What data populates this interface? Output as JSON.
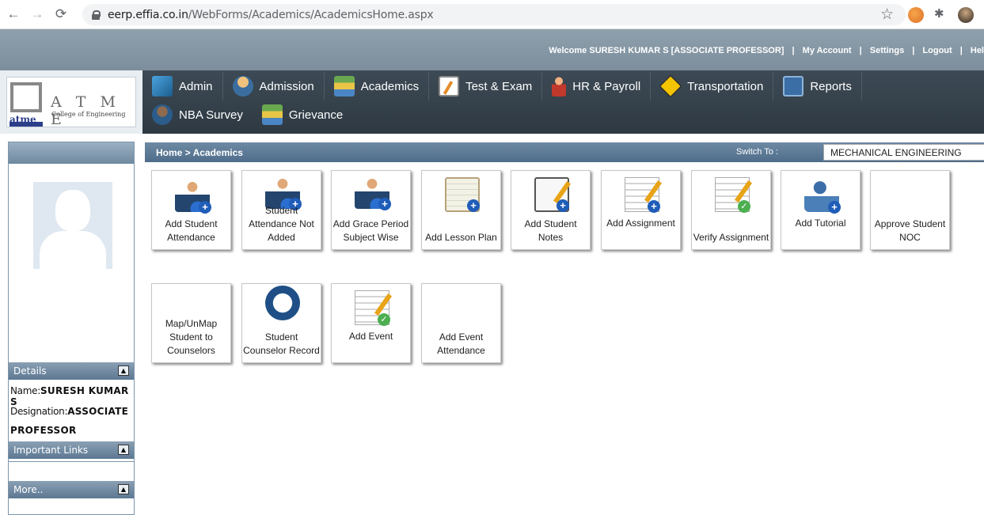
{
  "browser": {
    "url_host": "eerp.effia.co.in",
    "url_path": "/WebForms/Academics/AcademicsHome.aspx"
  },
  "header": {
    "welcome": "Welcome SURESH KUMAR S [ASSOCIATE PROFESSOR]",
    "links": [
      "My Account",
      "Settings",
      "Logout",
      "Hel"
    ],
    "separator": "|"
  },
  "logo": {
    "letters": "A T M E",
    "subtitle": "College of Engineering",
    "short": "atme"
  },
  "menu": {
    "row1": [
      {
        "label": "Admin",
        "icon": "admin-icon"
      },
      {
        "label": "Admission",
        "icon": "admission-icon"
      },
      {
        "label": "Academics",
        "icon": "academics-icon"
      },
      {
        "label": "Test & Exam",
        "icon": "test-exam-icon"
      },
      {
        "label": "HR & Payroll",
        "icon": "hr-payroll-icon"
      },
      {
        "label": "Transportation",
        "icon": "transportation-icon"
      },
      {
        "label": "Reports",
        "icon": "reports-icon"
      }
    ],
    "row2": [
      {
        "label": "NBA Survey",
        "icon": "nba-survey-icon"
      },
      {
        "label": "Grievance",
        "icon": "grievance-icon"
      }
    ]
  },
  "sidebar": {
    "details_title": "Details",
    "name_label": "Name:",
    "name_value": "SURESH KUMAR S",
    "designation_label": "Designation:",
    "designation_value_1": "ASSOCIATE",
    "designation_value_2": "PROFESSOR",
    "links_title": "Important Links",
    "more_title": "More..",
    "toggle": "▲"
  },
  "content": {
    "breadcrumb": "Home > Academics",
    "switch_label": "Switch To :",
    "department": "MECHANICAL ENGINEERING"
  },
  "tiles": {
    "row1": [
      {
        "label": "Add Student Attendance",
        "icon": "teacher-add-icon"
      },
      {
        "label": "Student Attendance Not Added",
        "icon": "teacher-add-icon"
      },
      {
        "label": "Add Grace Period Subject Wise",
        "icon": "teacher-add-icon"
      },
      {
        "label": "Add Lesson Plan",
        "icon": "lesson-plan-icon"
      },
      {
        "label": "Add Student Notes",
        "icon": "notes-icon"
      },
      {
        "label": "Add Assignment",
        "icon": "assignment-icon"
      },
      {
        "label": "Verify Assignment",
        "icon": "verify-assignment-icon"
      },
      {
        "label": "Add Tutorial",
        "icon": "tutorial-icon"
      },
      {
        "label": "Approve Student NOC",
        "icon": ""
      }
    ],
    "row2": [
      {
        "label": "Map/UnMap Student to Counselors",
        "icon": ""
      },
      {
        "label": "Student Counselor Record",
        "icon": "counselor-record-icon"
      },
      {
        "label": "Add Event",
        "icon": "event-icon"
      },
      {
        "label": "Add Event Attendance",
        "icon": ""
      }
    ]
  }
}
